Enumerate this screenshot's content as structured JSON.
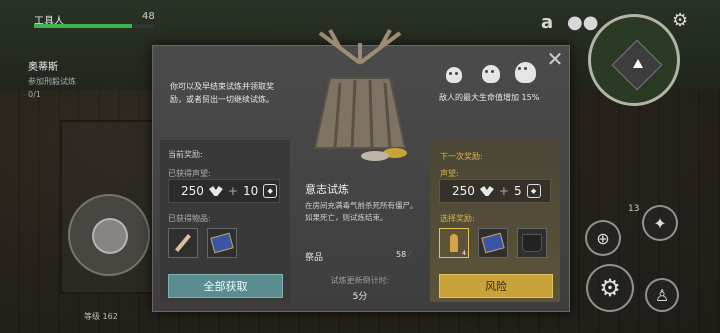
{
  "hud": {
    "name": "工具人",
    "level": "48",
    "quest_title": "奥蒂斯",
    "quest_sub": "参加刑毅试炼",
    "quest_progress": "0/1",
    "bottom_level": "等级 162"
  },
  "dialog": {
    "intro": "你可以及早结束试炼并领取奖励，或者贸出一切继续试炼。",
    "current_reward_label": "当前奖励:",
    "reputation_label": "已获得声望:",
    "rep_value_a": "250",
    "rep_plus": "+",
    "rep_value_b": "10",
    "items_label": "已获得物品:",
    "collect_button": "全部获取",
    "trial_title": "意志试炼",
    "trial_desc": "在房间充满毒气前杀死所有僵尸。如果死亡，则试炼结束。",
    "sacrifice_label": "祭品",
    "sacrifice_count": "58",
    "refresh_label": "试炼更新倒计时:",
    "refresh_value": "5分",
    "danger_text": "敌人的最大生命值增加 15%",
    "next_reward_label": "下一次奖励:",
    "next_rep_label": "声望:",
    "next_rep_a": "250",
    "next_rep_plus": "+",
    "next_rep_b": "5",
    "choose_label": "选择奖励:",
    "choose_item_count": "4",
    "risk_button": "风险"
  },
  "minimap_number": "13",
  "colors": {
    "collect": "#5b8c8f",
    "risk": "#c9a23a",
    "hp": "#39b54a"
  }
}
